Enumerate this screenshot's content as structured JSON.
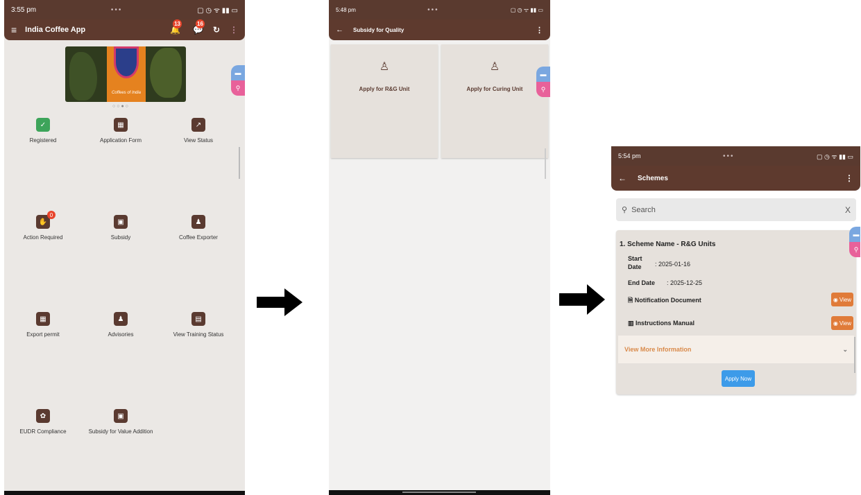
{
  "screen1": {
    "status_time": "3:55 pm",
    "app_title": "India Coffee App",
    "notif_badge": "13",
    "msg_badge": "16",
    "banner_caption": "Coffees of India",
    "tiles": [
      {
        "label": "Registered",
        "icon": "✓",
        "green": true
      },
      {
        "label": "Application Form",
        "icon": "▦"
      },
      {
        "label": "View Status",
        "icon": "↗"
      },
      {
        "label": "Action Required",
        "icon": "✋",
        "badge": "0"
      },
      {
        "label": "Subsidy",
        "icon": "▣"
      },
      {
        "label": "Coffee Exporter",
        "icon": "♟"
      },
      {
        "label": "Export permit",
        "icon": "▦"
      },
      {
        "label": "Advisories",
        "icon": "♟"
      },
      {
        "label": "View Training Status",
        "icon": "▤"
      },
      {
        "label": "EUDR Compliance",
        "icon": "✿"
      },
      {
        "label": "Subsidy for Value Addition",
        "icon": "▣"
      }
    ]
  },
  "screen2": {
    "status_time": "5:48 pm",
    "title": "Subsidy for Quality",
    "card1": "Apply for R&G Unit",
    "card2": "Apply for Curing Unit"
  },
  "screen3": {
    "status_time": "5:54 pm",
    "title": "Schemes",
    "search_placeholder": "Search",
    "clear": "X",
    "scheme_name": "1. Scheme Name -  R&G Units",
    "start_label": "Start Date",
    "start_value": ": 2025-01-16",
    "end_label": "End Date",
    "end_value": ": 2025-12-25",
    "notification_doc": "Notification Document",
    "instructions_manual": "Instructions Manual",
    "view_label": "View",
    "view_more": "View More Information",
    "apply_now": "Apply Now"
  },
  "colors": {
    "brand_brown": "#5e3a2e",
    "screen_bg": "#ebe7e4",
    "card_bg": "#e6e1dc",
    "view_orange": "#e07b39",
    "apply_blue": "#3d9be9"
  }
}
